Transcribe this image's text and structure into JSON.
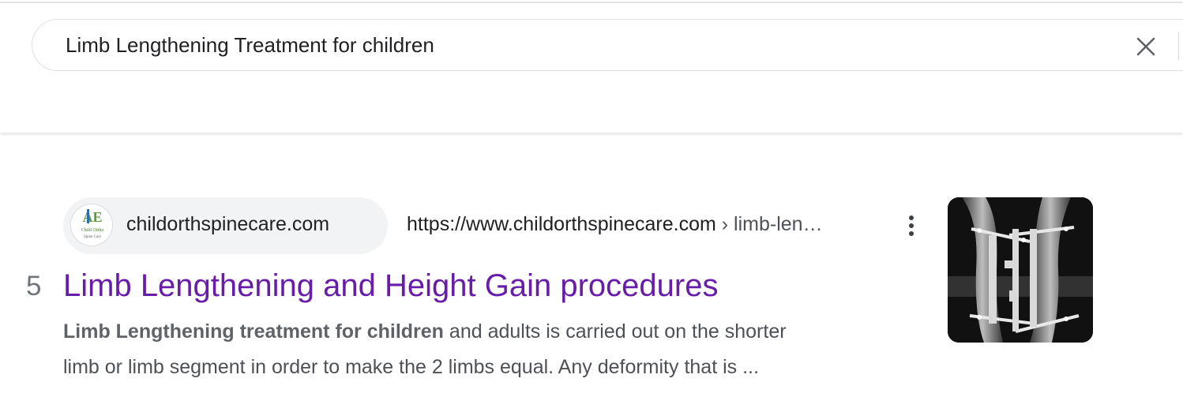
{
  "search": {
    "query": "Limb Lengthening Treatment for children",
    "clear_icon": "close-icon"
  },
  "result": {
    "rank": "5",
    "site_name": "childorthspinecare.com",
    "url_base": "https://www.childorthspinecare.com",
    "url_path": " › limb-len…",
    "title": "Limb Lengthening and Height Gain procedures",
    "snippet_bold": "Limb Lengthening treatment for children",
    "snippet_line1_rest": " and adults is carried out on the shorter",
    "snippet_line2": "limb or limb segment in order to make the 2 limbs equal. Any deformity that is ...",
    "more_icon": "more-vert-icon",
    "favicon_icon": "site-logo-icon",
    "thumbnail_icon": "xray-thumbnail-icon"
  },
  "colors": {
    "title_visited": "#681da8",
    "text": "#202124",
    "snippet": "#4d5156",
    "chip_bg": "#f1f3f4"
  }
}
